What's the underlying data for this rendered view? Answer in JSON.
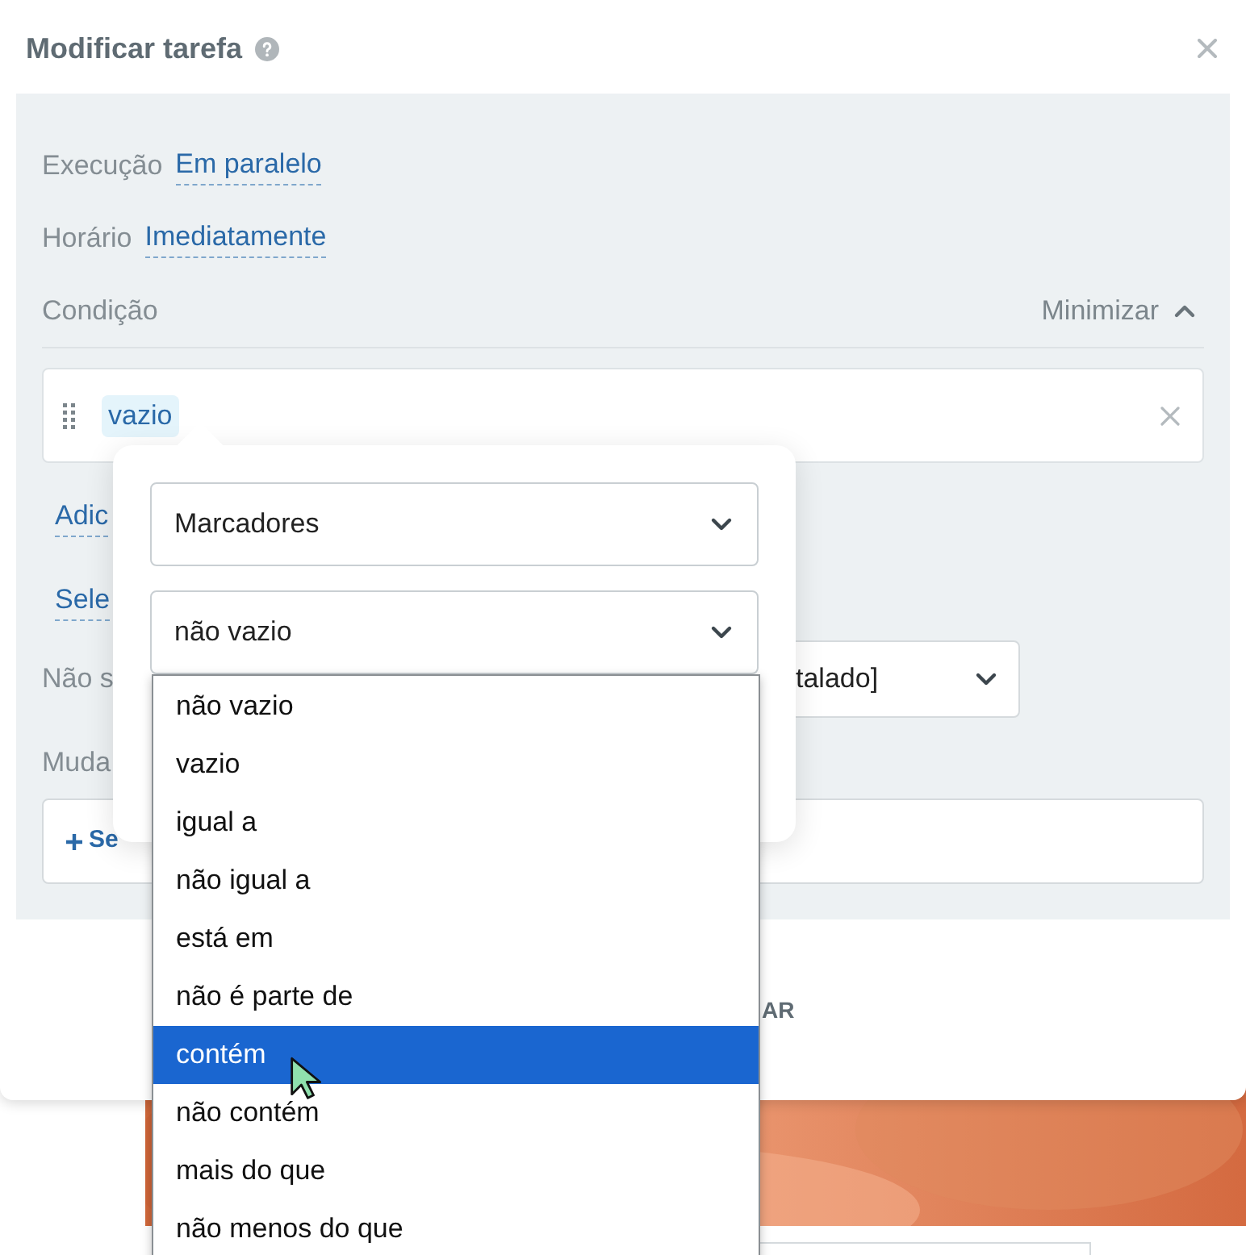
{
  "dialog": {
    "title": "Modificar tarefa",
    "fields": [
      {
        "label": "Execução",
        "value": "Em paralelo"
      },
      {
        "label": "Horário",
        "value": "Imediatamente"
      }
    ],
    "condition": {
      "label": "Condição",
      "toggle": "Minimizar",
      "expanded": true,
      "chip": "vazio"
    },
    "links": [
      "Adic",
      "Sele"
    ],
    "select_row": {
      "label": "Não s",
      "value": "talado]"
    },
    "change": {
      "label": "Muda",
      "button": "Se"
    },
    "footer_button": "AR"
  },
  "popover": {
    "field_select": "Marcadores",
    "operator_select": "não vazio",
    "options": [
      {
        "label": "não vazio",
        "selected": false
      },
      {
        "label": "vazio",
        "selected": false
      },
      {
        "label": "igual a",
        "selected": false
      },
      {
        "label": "não igual a",
        "selected": false
      },
      {
        "label": "está em",
        "selected": false
      },
      {
        "label": "não é parte de",
        "selected": false
      },
      {
        "label": "contém",
        "selected": true
      },
      {
        "label": "não contém",
        "selected": false
      },
      {
        "label": "mais do que",
        "selected": false
      },
      {
        "label": "não menos do que",
        "selected": false
      }
    ]
  }
}
